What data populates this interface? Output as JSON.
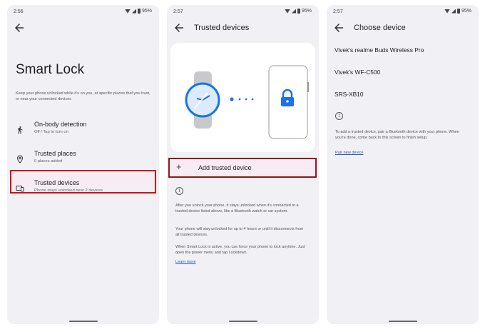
{
  "screens": [
    {
      "status_time": "2:56",
      "status_battery": "95%",
      "title": "Smart Lock",
      "description": "Keep your phone unlocked while it's on you, at specific places that you trust, or near your connected devices",
      "items": [
        {
          "label": "On-body detection",
          "sub": "Off / Tap to turn on",
          "icon": "walk-icon"
        },
        {
          "label": "Trusted places",
          "sub": "0 places added",
          "icon": "location-pin-icon"
        },
        {
          "label": "Trusted devices",
          "sub": "Phone stays unlocked near 2 devices",
          "icon": "devices-icon"
        }
      ]
    },
    {
      "status_time": "2:57",
      "status_battery": "95%",
      "title": "Trusted devices",
      "add_label": "Add trusted device",
      "paragraphs": [
        "After you unlock your phone, it stays unlocked when it's connected to a trusted device listed above, like a Bluetooth watch or car system.",
        "Your phone will stay unlocked for up to 4 hours or until it disconnects from all trusted devices.",
        "When Smart Lock is active, you can force your phone to lock anytime. Just open the power menu and tap Lockdown."
      ],
      "learn_more": "Learn more"
    },
    {
      "status_time": "2:57",
      "status_battery": "95%",
      "title": "Choose device",
      "devices": [
        "Vivek's realme Buds Wireless Pro",
        "Vivek's WF-C500",
        "SRS-XB10"
      ],
      "info": "To add a trusted device, pair a Bluetooth device with your phone. When you're done, come back to this screen to finish setup.",
      "pair_link": "Pair new device"
    }
  ],
  "colors": {
    "accent": "#1a73e8",
    "highlight_box": "#cc1111",
    "link": "#2a5db0",
    "background": "#f1f0f5"
  }
}
